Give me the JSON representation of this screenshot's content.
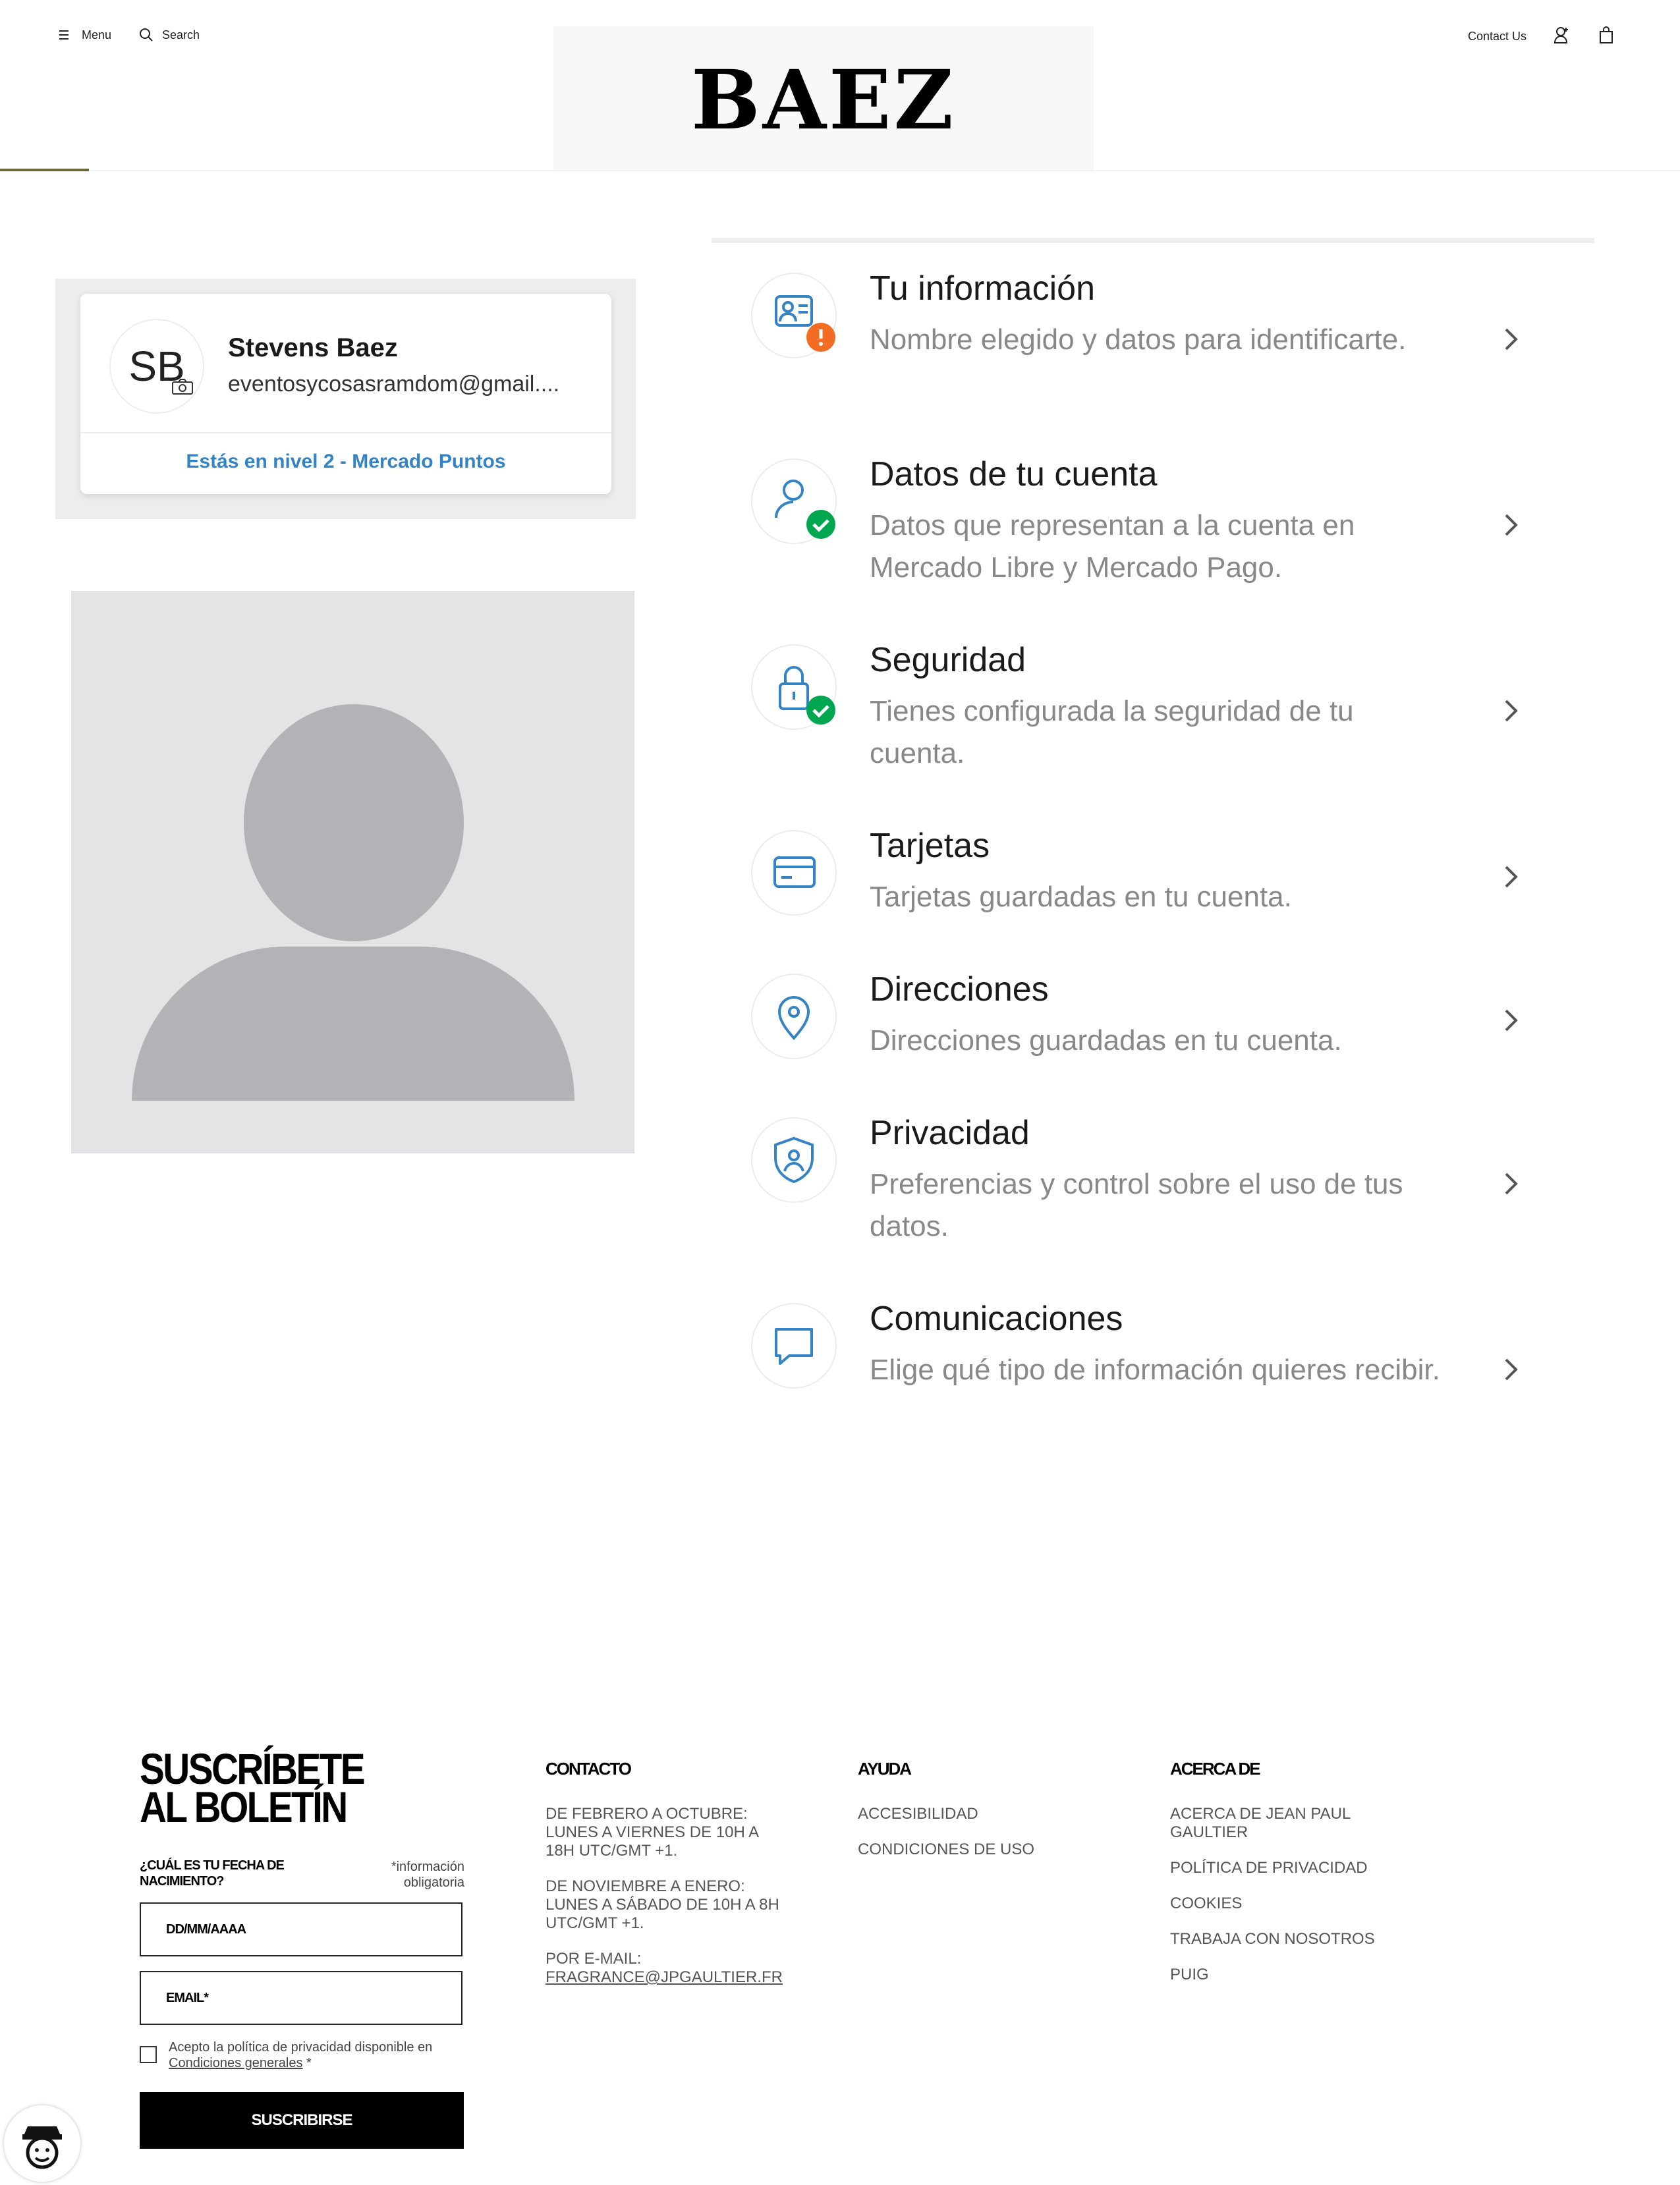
{
  "header": {
    "menu_label": "Menu",
    "search_label": "Search",
    "contact_label": "Contact Us",
    "logo_text": "BAEZ"
  },
  "profile": {
    "initials": "SB",
    "name": "Stevens Baez",
    "email": "eventosycosasramdom@gmail....",
    "level_link": "Estás en nivel 2 - Mercado Puntos",
    "accent_color": "#3483c4"
  },
  "menu": {
    "items": [
      {
        "title": "Tu información",
        "desc": "Nombre elegido y datos para identificarte.",
        "icon": "id-card-icon",
        "badge": "warning"
      },
      {
        "title": "Datos de tu cuenta",
        "desc": "Datos que representan a la cuenta en Mercado Libre y Mercado Pago.",
        "icon": "user-icon",
        "badge": "check"
      },
      {
        "title": "Seguridad",
        "desc": "Tienes configurada la seguridad de tu cuenta.",
        "icon": "lock-icon",
        "badge": "check"
      },
      {
        "title": "Tarjetas",
        "desc": "Tarjetas guardadas en tu cuenta.",
        "icon": "credit-card-icon"
      },
      {
        "title": "Direcciones",
        "desc": "Direcciones guardadas en tu cuenta.",
        "icon": "location-pin-icon"
      },
      {
        "title": "Privacidad",
        "desc": "Preferencias y control sobre el uso de tus datos.",
        "icon": "privacy-shield-icon"
      },
      {
        "title": "Comunicaciones",
        "desc": "Elige qué tipo de información quieres recibir.",
        "icon": "chat-bubble-icon"
      }
    ],
    "icon_color": "#3483c4",
    "warning_color": "#f26d23",
    "check_color": "#00a650"
  },
  "newsletter": {
    "title": "SUSCRÍBETE AL BOLETÍN",
    "birth_question": "¿CUÁL ES TU FECHA DE NACIMIENTO?",
    "required_note": "*información obligatoria",
    "date_placeholder": "DD/MM/AAAA",
    "email_placeholder": "EMAIL*",
    "accept_text": "Acepto la política de privacidad disponible en",
    "accept_link": "Condiciones generales",
    "accept_suffix": " *",
    "button": "SUSCRIBIRSE"
  },
  "footer": {
    "contact": {
      "heading": "CONTACTO",
      "lines": [
        "DE FEBRERO A OCTUBRE: LUNES A VIERNES DE 10H A 18H UTC/GMT +1.",
        "DE NOVIEMBRE A ENERO: LUNES A SÁBADO DE 10H A 8H UTC/GMT +1.",
        "POR E-MAIL:"
      ],
      "email": "FRAGRANCE@JPGAULTIER.FR"
    },
    "help": {
      "heading": "AYUDA",
      "links": [
        "ACCESIBILIDAD",
        "CONDICIONES DE USO"
      ]
    },
    "about": {
      "heading": "ACERCA DE",
      "links": [
        "ACERCA DE JEAN PAUL GAULTIER",
        "POLÍTICA DE PRIVACIDAD",
        "COOKIES",
        "TRABAJA CON NOSOTROS",
        "PUIG"
      ]
    }
  }
}
